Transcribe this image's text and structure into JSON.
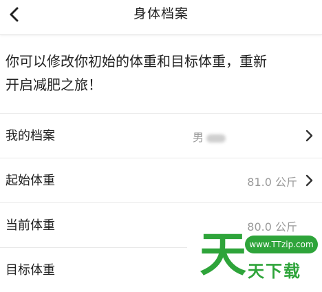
{
  "header": {
    "title": "身体档案",
    "back_icon": "chevron-left-icon"
  },
  "intro": {
    "text_line1": "你可以修改你初始的体重和目标体重，重新",
    "text_line2": "开启减肥之旅！"
  },
  "rows": [
    {
      "label": "我的档案",
      "value": "男",
      "value_blurred": true,
      "chevron": true
    },
    {
      "label": "起始体重",
      "value": "81.0 公斤",
      "chevron": true
    },
    {
      "label": "当前体重",
      "value": "80.0 公斤",
      "chevron": false
    },
    {
      "label": "目标体重",
      "value": "",
      "chevron": false
    }
  ],
  "watermark": {
    "big_char": "天",
    "url": "www.TTzip.com",
    "text": "天下载"
  },
  "colors": {
    "text": "#222222",
    "value": "#9a9a9a",
    "divider": "#e8e8e8",
    "watermark": "#2ea43a"
  }
}
